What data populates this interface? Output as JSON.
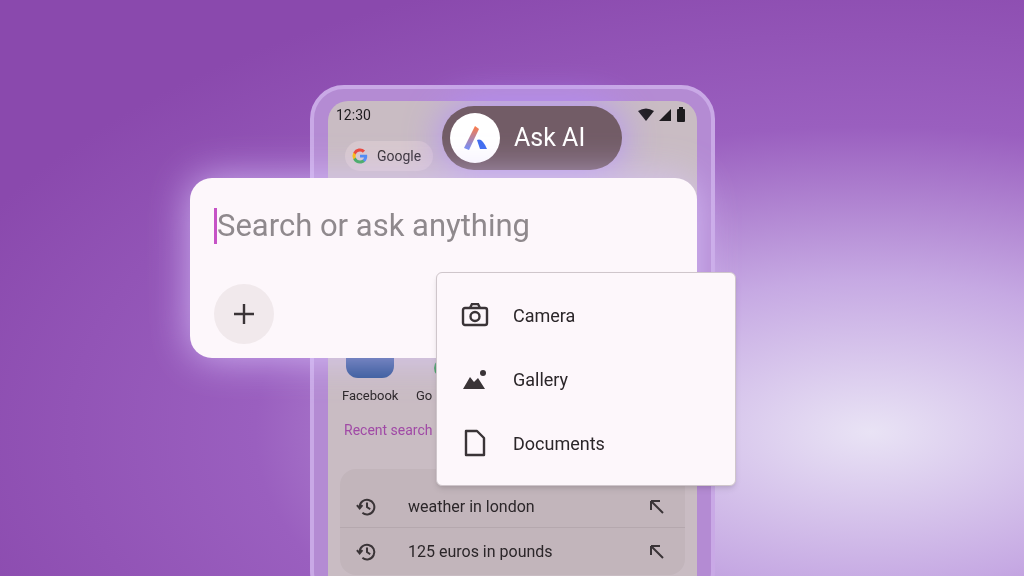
{
  "status_bar": {
    "time": "12:30"
  },
  "chip": {
    "label": "Google"
  },
  "ask_ai": {
    "label": "Ask AI"
  },
  "search": {
    "placeholder": "Search or ask anything"
  },
  "attach_menu": [
    {
      "label": "Camera",
      "kind": "camera"
    },
    {
      "label": "Gallery",
      "kind": "gallery"
    },
    {
      "label": "Documents",
      "kind": "document"
    }
  ],
  "shortcuts": [
    {
      "label": "Facebook",
      "kind": "facebook"
    },
    {
      "label": "Go",
      "kind": "circle"
    }
  ],
  "recent": {
    "title": "Recent search",
    "items": [
      {
        "query": "weather in london"
      },
      {
        "query": "125 euros in pounds"
      }
    ]
  }
}
